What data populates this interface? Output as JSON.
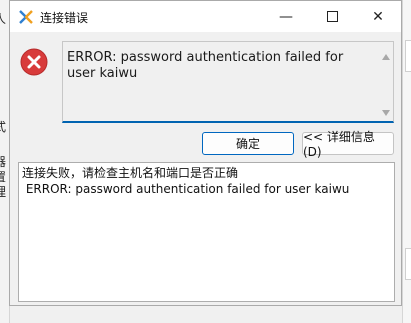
{
  "background": {
    "chars": [
      "人",
      "式",
      "器",
      "置",
      "理"
    ]
  },
  "window": {
    "title": "连接错误",
    "minimize": "—",
    "close": "✕"
  },
  "icons": {
    "app": "kaiwu-logo-icon",
    "error": "error-icon"
  },
  "message": {
    "text": "ERROR: password authentication failed for user kaiwu"
  },
  "buttons": {
    "ok": "确定",
    "details": "<< 详细信息(D)"
  },
  "details": {
    "line1": "连接失败，请检查主机名和端口是否正确",
    "line2": " ERROR: password authentication failed for user kaiwu"
  },
  "colors": {
    "accent": "#0067c0",
    "error": "#e03c3c"
  }
}
